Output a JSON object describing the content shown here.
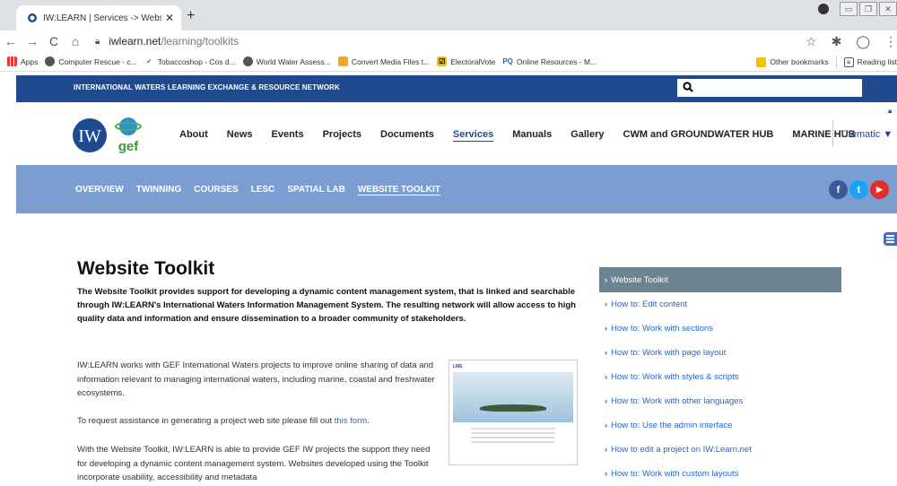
{
  "browser": {
    "tab_title": "IW:LEARN | Services -> Website To",
    "url_domain": "iwlearn.net",
    "url_path": "/learning/toolkits",
    "bookmarks": [
      {
        "label": "Apps",
        "icon": "apps-grid-icon"
      },
      {
        "label": "Computer Rescue - c...",
        "icon": "globe-icon"
      },
      {
        "label": "Tobaccoshop - Cos d...",
        "icon": "check-icon"
      },
      {
        "label": "World Water Assess...",
        "icon": "globe-icon"
      },
      {
        "label": "Convert Media Files t...",
        "icon": "convert-icon"
      },
      {
        "label": "ElectoralVote",
        "icon": "vote-icon"
      },
      {
        "label": "Online Resources - M...",
        "icon": "pq-icon",
        "icon_text": "PQ"
      }
    ],
    "other_bookmarks": "Other bookmarks",
    "reading_list": "Reading list"
  },
  "site": {
    "network_title": "INTERNATIONAL WATERS LEARNING EXCHANGE & RESOURCE NETWORK",
    "logo_text": {
      "iw": "IW",
      "gef": "gef"
    },
    "menu": [
      "About",
      "News",
      "Events",
      "Projects",
      "Documents",
      "Services",
      "Manuals",
      "Gallery",
      "CWM and GROUNDWATER HUB",
      "MARINE HUB"
    ],
    "active_menu": "Services",
    "thematic": "Thematic",
    "submenu": [
      "OVERVIEW",
      "TWINNING",
      "COURSES",
      "LESC",
      "SPATIAL LAB",
      "WEBSITE TOOLKIT"
    ],
    "active_submenu": "WEBSITE TOOLKIT",
    "social": {
      "facebook": "f",
      "twitter": "t",
      "youtube": "▶"
    },
    "colors": {
      "primary": "#1f4b8e",
      "subnav": "#7b9ed1",
      "link": "#2866c6",
      "sidebar_head": "#6b8490"
    }
  },
  "content": {
    "title": "Website Toolkit",
    "lead": "The Website Toolkit provides support for developing a dynamic content management system, that is linked and searchable through IW:LEARN's International Waters Information Management System. The resulting network will allow access to high quality data and information and ensure dissemination to a broader community of stakeholders.",
    "p1": "IW:LEARN works with GEF International Waters projects to improve online sharing of data and information relevant to managing international waters, including marine, coastal and freshwater ecosystems.",
    "p2_before": "To request assistance in generating a project web site please fill out ",
    "p2_link": "this form",
    "p2_after": ".",
    "p3": "With the  Website Toolkit, IW:LEARN is able to provide GEF IW projects the support they need for developing a dynamic content management system. Websites developed using the Toolkit incorporate usability, accessibility and metadata",
    "thumb_brand": "LME"
  },
  "sidebar": {
    "heading": "Website Toolkit",
    "items": [
      "How to: Edit content",
      "How to: Work with sections",
      "How to: Work with page layout",
      "How to: Work with styles & scripts",
      "How to: Work with other languages",
      "How to: Use the admin interface",
      "How to edit a project on IW:Learn.net",
      "How to: Work with custom layouts"
    ]
  }
}
